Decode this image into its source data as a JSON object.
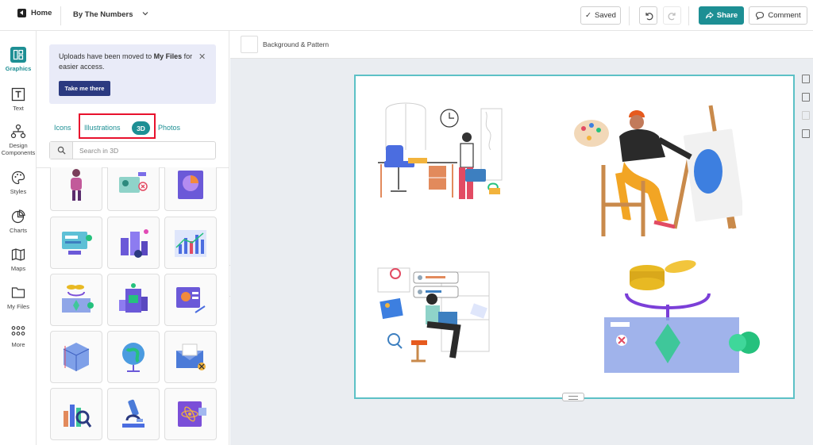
{
  "topbar": {
    "home_label": "Home",
    "project_title": "By The Numbers",
    "saved_label": "Saved",
    "share_label": "Share",
    "comment_label": "Comment"
  },
  "rail": {
    "items": [
      {
        "label": "Graphics",
        "icon": "graphics-icon"
      },
      {
        "label": "Text",
        "icon": "text-icon"
      },
      {
        "label": "Design Components",
        "icon": "design-components-icon"
      },
      {
        "label": "Styles",
        "icon": "palette-icon"
      },
      {
        "label": "Charts",
        "icon": "pie-chart-icon"
      },
      {
        "label": "Maps",
        "icon": "map-icon"
      },
      {
        "label": "My Files",
        "icon": "folder-icon"
      },
      {
        "label": "More",
        "icon": "grid-icon"
      }
    ]
  },
  "panel": {
    "notice": {
      "text_before": "Uploads have been moved to ",
      "text_bold": "My Files",
      "text_after": " for easier access.",
      "button_label": "Take me there"
    },
    "tabs": [
      {
        "label": "Icons"
      },
      {
        "label": "Illustrations"
      },
      {
        "label": "3D",
        "active": true
      },
      {
        "label": "Photos"
      }
    ],
    "search_placeholder": "Search in 3D",
    "thumbnails": [
      "3d-person-figure",
      "3d-profile-card",
      "3d-pie-chart",
      "3d-chat-screen",
      "3d-city-buildings",
      "3d-bar-chart",
      "3d-coin-flow",
      "3d-server-tower",
      "3d-dashboard-card",
      "3d-cube-grid",
      "3d-globe",
      "3d-envelope",
      "3d-magnifier-bars",
      "3d-microscope",
      "3d-atom-card"
    ]
  },
  "canvas": {
    "background_label": "Background & Pattern"
  },
  "colors": {
    "accent": "#1d8f94",
    "notice_bg": "#e9ebf8",
    "button_dark": "#2b3a80",
    "highlight": "#e8112d",
    "canvas_border": "#5cc1c6"
  }
}
